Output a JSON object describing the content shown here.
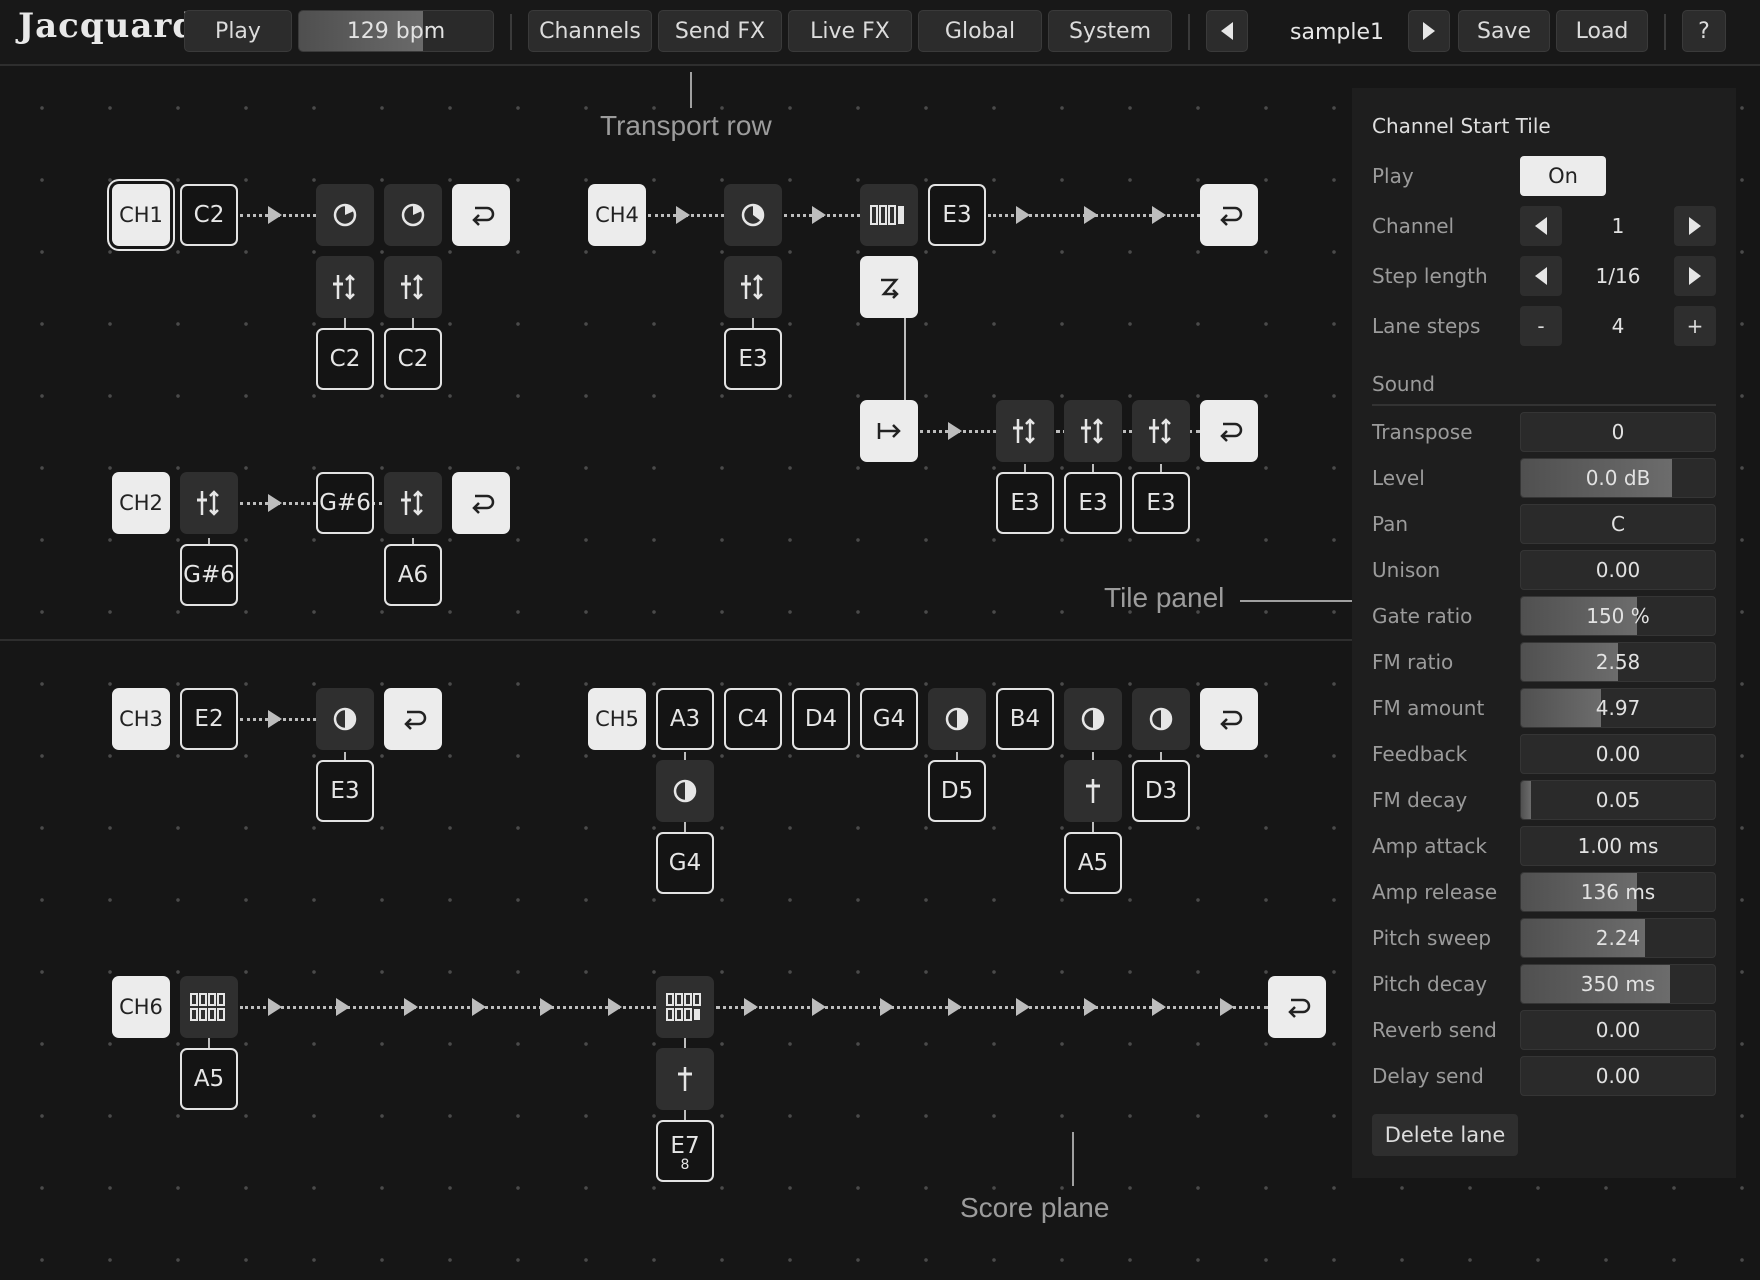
{
  "app": {
    "logo": "Jacquard"
  },
  "toolbar": {
    "play_label": "Play",
    "bpm": "129 bpm",
    "bpm_level": 0.64,
    "tabs": [
      "Channels",
      "Send FX",
      "Live FX",
      "Global",
      "System"
    ],
    "sample_name": "sample1",
    "save_label": "Save",
    "load_label": "Load",
    "help_label": "?"
  },
  "annotations": {
    "transport": "Transport row",
    "tile_panel": "Tile panel",
    "score": "Score plane"
  },
  "score": {
    "ch1": {
      "label": "CH1",
      "start_note": "C2",
      "notes": [
        "C2",
        "C2"
      ]
    },
    "ch2": {
      "label": "CH2",
      "notes": [
        "G#6",
        "G#6",
        "A6"
      ]
    },
    "ch3": {
      "label": "CH3",
      "start_note": "E2",
      "notes": [
        "E3"
      ]
    },
    "ch4": {
      "label": "CH4",
      "notes": [
        "E3",
        "E3",
        "E3",
        "E3",
        "E3",
        "E3"
      ]
    },
    "ch5": {
      "label": "CH5",
      "seq": [
        "A3",
        "C4",
        "D4",
        "G4",
        "B4"
      ],
      "branch": [
        "G4",
        "D5",
        "A5",
        "D3"
      ]
    },
    "ch6": {
      "label": "CH6",
      "notes": [
        "A5",
        "E7"
      ],
      "sub": "8"
    }
  },
  "panel": {
    "title": "Channel Start Tile",
    "play_label": "Play",
    "play_value": "On",
    "channel_label": "Channel",
    "channel_value": "1",
    "step_label": "Step length",
    "step_value": "1/16",
    "lane_label": "Lane steps",
    "lane_value": "4",
    "minus": "-",
    "plus": "+",
    "sound_label": "Sound",
    "params": [
      {
        "label": "Transpose",
        "value": "0",
        "fill": 0
      },
      {
        "label": "Level",
        "value": "0.0 dB",
        "fill": 0.78
      },
      {
        "label": "Pan",
        "value": "C",
        "fill": 0
      },
      {
        "label": "Unison",
        "value": "0.00",
        "fill": 0
      },
      {
        "label": "Gate ratio",
        "value": "150 %",
        "fill": 0.6
      },
      {
        "label": "FM ratio",
        "value": "2.58",
        "fill": 0.5
      },
      {
        "label": "FM amount",
        "value": "4.97",
        "fill": 0.41
      },
      {
        "label": "Feedback",
        "value": "0.00",
        "fill": 0
      },
      {
        "label": "FM decay",
        "value": "0.05",
        "fill": 0.05
      },
      {
        "label": "Amp attack",
        "value": "1.00 ms",
        "fill": 0
      },
      {
        "label": "Amp release",
        "value": "136 ms",
        "fill": 0.6
      },
      {
        "label": "Pitch sweep",
        "value": "2.24",
        "fill": 0.64
      },
      {
        "label": "Pitch decay",
        "value": "350 ms",
        "fill": 0.77
      },
      {
        "label": "Reverb send",
        "value": "0.00",
        "fill": 0
      },
      {
        "label": "Delay send",
        "value": "0.00",
        "fill": 0
      }
    ],
    "delete_label": "Delete lane"
  }
}
